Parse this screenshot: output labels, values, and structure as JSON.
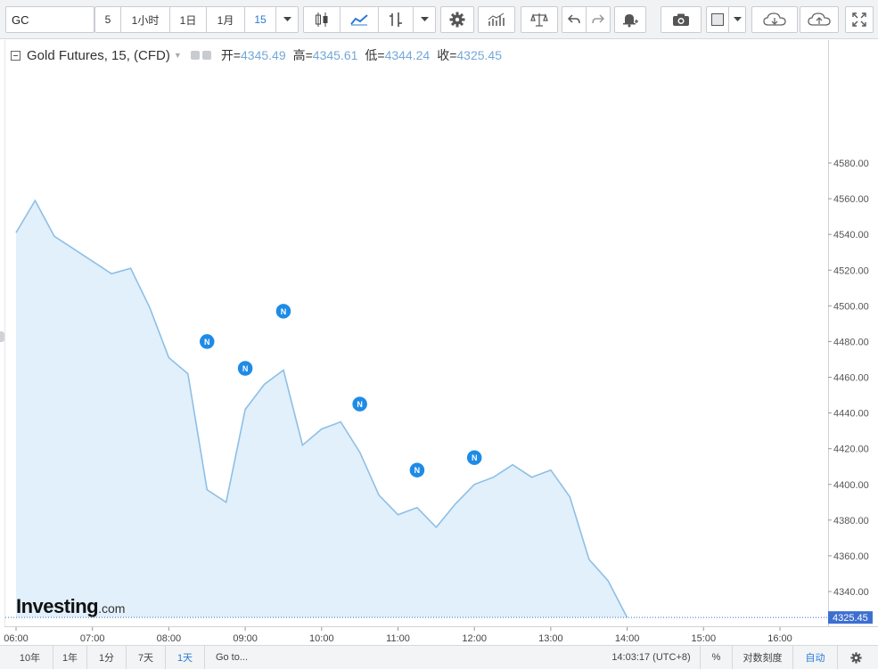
{
  "toolbar": {
    "symbol": "GC",
    "intervals": [
      "5",
      "1小时",
      "1日",
      "1月",
      "15"
    ],
    "active_interval": "15",
    "accent": "#2a7ad4"
  },
  "legend": {
    "title": "Gold Futures, 15, (CFD)",
    "open_label": "开=",
    "open": "4345.49",
    "high_label": "高=",
    "high": "4345.61",
    "low_label": "低=",
    "low": "4344.24",
    "close_label": "收=",
    "close": "4325.45"
  },
  "chart_data": {
    "type": "area",
    "line_color": "#8ebfe6",
    "fill_color": "#e1f0fa",
    "x": [
      "06:00",
      "06:15",
      "06:30",
      "06:45",
      "07:00",
      "07:15",
      "07:30",
      "07:45",
      "08:00",
      "08:15",
      "08:30",
      "08:45",
      "09:00",
      "09:15",
      "09:30",
      "09:45",
      "10:00",
      "10:15",
      "10:30",
      "10:45",
      "11:00",
      "11:15",
      "11:30",
      "11:45",
      "12:00",
      "12:15",
      "12:30",
      "12:45",
      "13:00",
      "13:15",
      "13:30",
      "13:45",
      "14:00"
    ],
    "values": [
      4541,
      4559,
      4539,
      4532,
      4525,
      4518,
      4521,
      4499,
      4471,
      4462,
      4397,
      4390,
      4442,
      4456,
      4464,
      4422,
      4431,
      4435,
      4418,
      4394,
      4383,
      4387,
      4376,
      4389,
      4400,
      4404,
      4411,
      4404,
      4408,
      4393,
      4358,
      4346,
      4325.45
    ],
    "y_ticks": [
      "4340.00",
      "4360.00",
      "4380.00",
      "4400.00",
      "4420.00",
      "4440.00",
      "4460.00",
      "4480.00",
      "4500.00",
      "4520.00",
      "4540.00",
      "4560.00",
      "4580.00"
    ],
    "x_ticks": [
      "06:00",
      "07:00",
      "08:00",
      "09:00",
      "10:00",
      "11:00",
      "12:00",
      "13:00",
      "14:00",
      "15:00",
      "16:00"
    ],
    "last_price_label": "4325.45",
    "last_price_color": "#3c6fd0",
    "news_markers": [
      {
        "label": "N",
        "time": "08:30",
        "price": 4480
      },
      {
        "label": "N",
        "time": "09:00",
        "price": 4465
      },
      {
        "label": "N",
        "time": "09:30",
        "price": 4497
      },
      {
        "label": "N",
        "time": "10:30",
        "price": 4445
      },
      {
        "label": "N",
        "time": "11:15",
        "price": 4408
      },
      {
        "label": "N",
        "time": "12:00",
        "price": 4415
      }
    ],
    "news_color": "#1e8be6"
  },
  "brand": {
    "main": "Investing",
    "suffix": ".com"
  },
  "bottombar": {
    "ranges": [
      "10年",
      "1年",
      "1分",
      "7天",
      "1天",
      "Go to..."
    ],
    "active_range": "1天",
    "clock": "14:03:17 (UTC+8)",
    "percent": "%",
    "log_scale": "对数刻度",
    "auto": "自动"
  }
}
